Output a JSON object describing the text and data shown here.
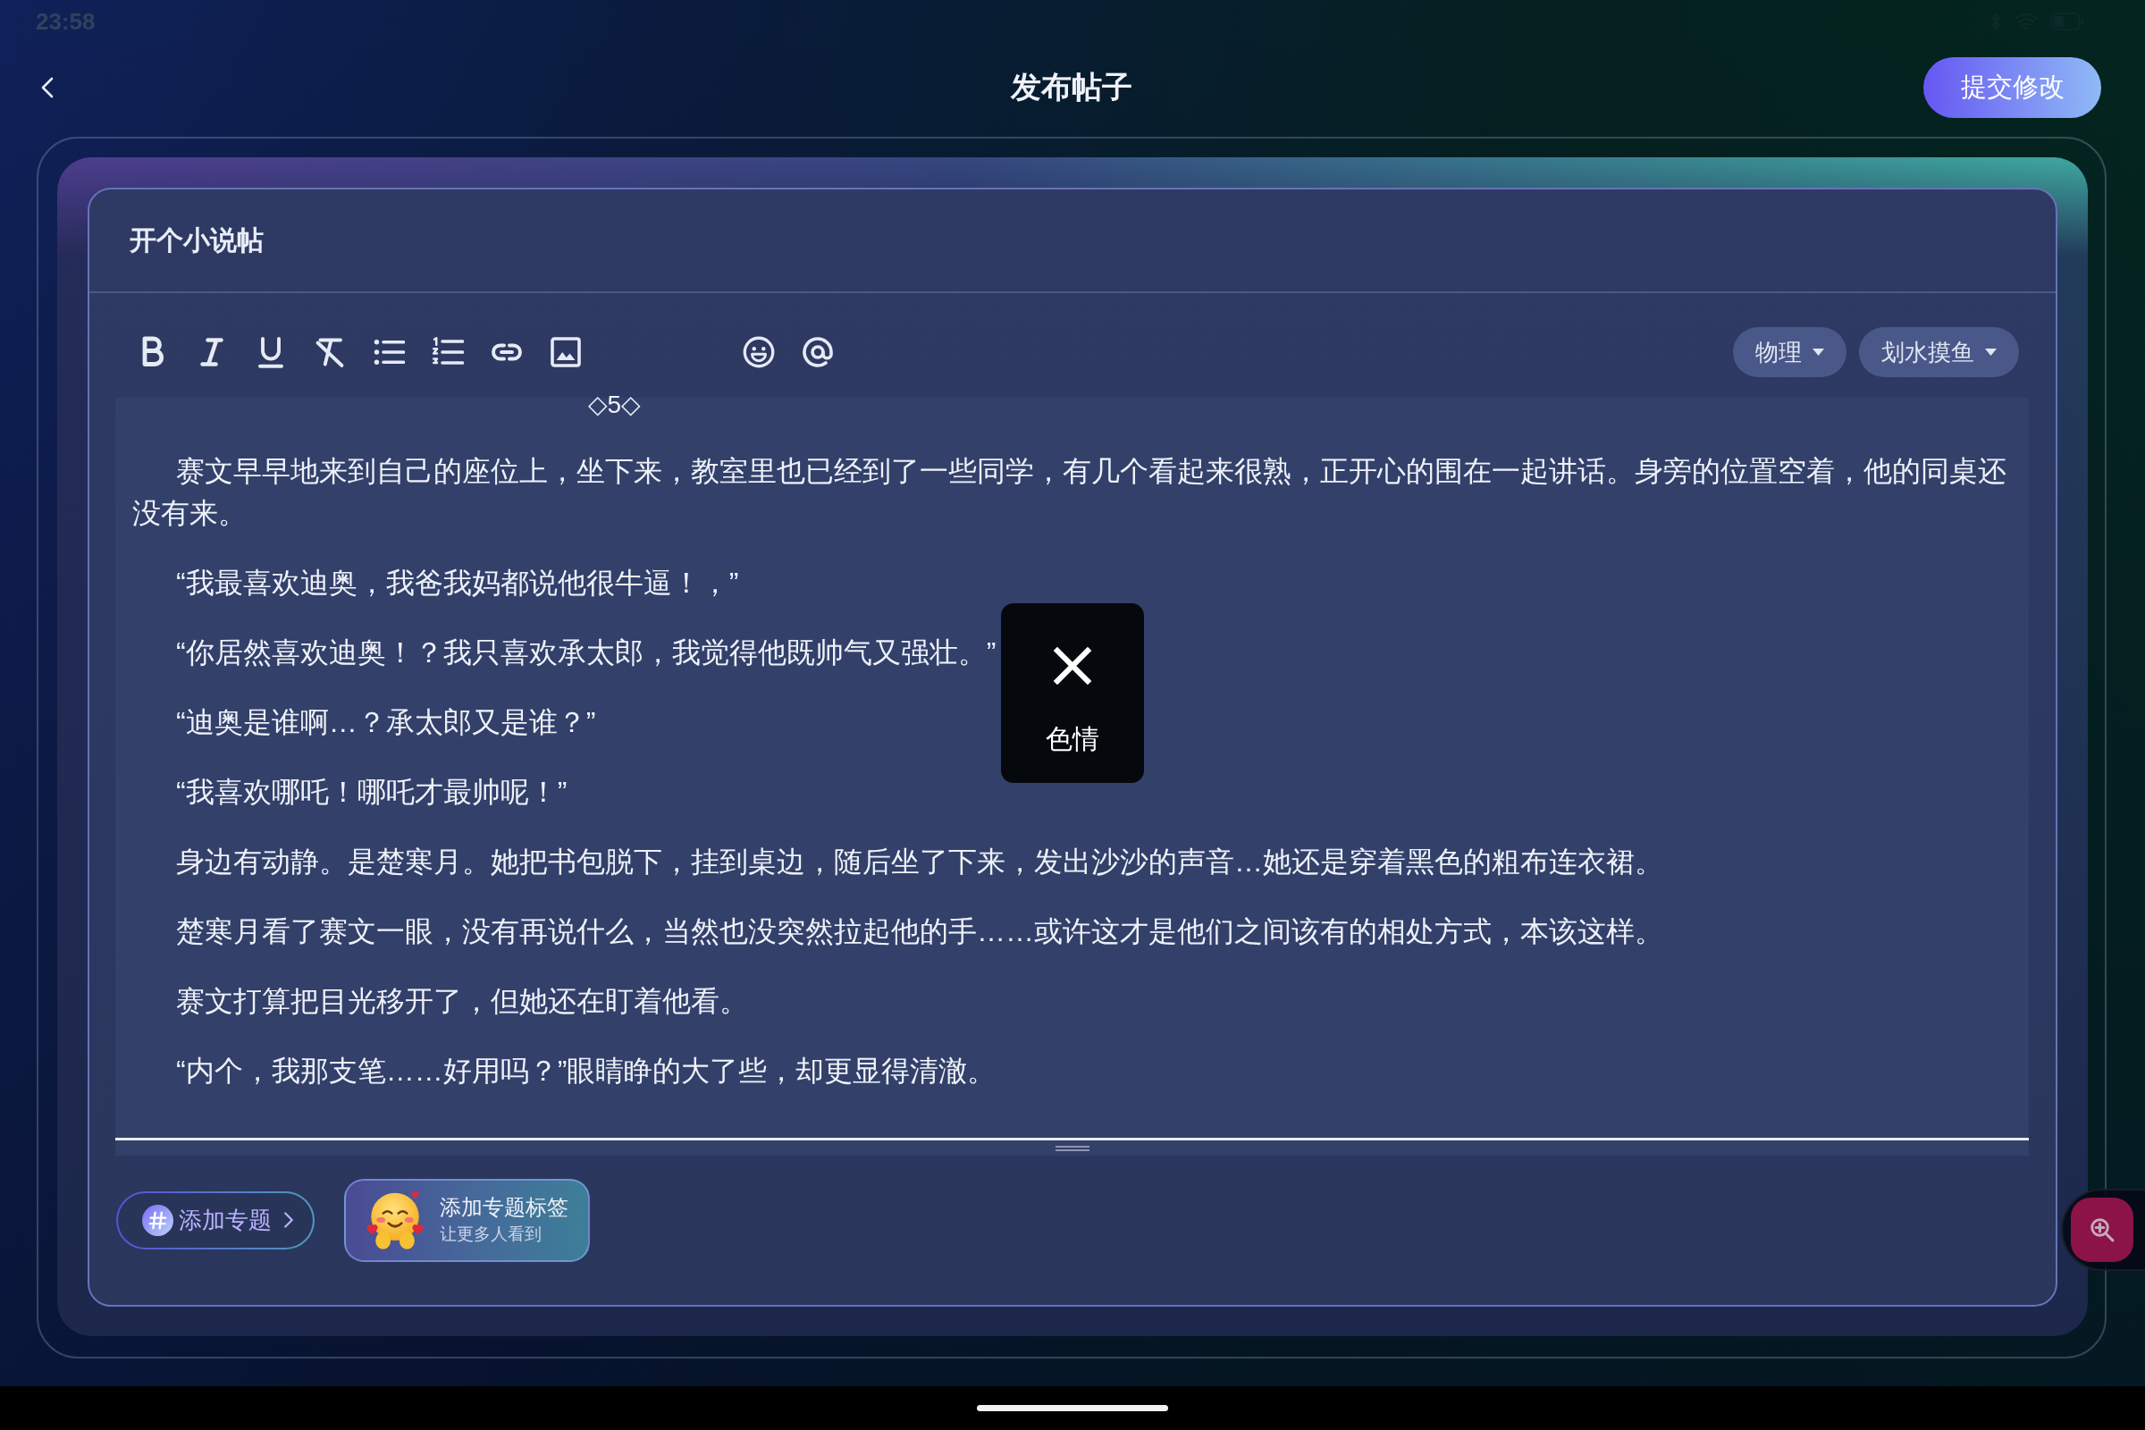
{
  "status_bar": {
    "time": "23:58"
  },
  "header": {
    "title": "发布帖子",
    "submit": "提交修改"
  },
  "post_title": "开个小说帖",
  "tag_dropdowns": [
    "物理",
    "划水摸鱼"
  ],
  "editor": {
    "marker": "◇5◇",
    "paragraphs": [
      "赛文早早地来到自己的座位上，坐下来，教室里也已经到了一些同学，有几个看起来很熟，正开心的围在一起讲话。身旁的位置空着，他的同桌还没有来。",
      "“我最喜欢迪奥，我爸我妈都说他很牛逼！，”",
      "“你居然喜欢迪奥！？我只喜欢承太郎，我觉得他既帅气又强壮。”",
      "“迪奥是谁啊…？承太郎又是谁？”",
      "“我喜欢哪吒！哪吒才最帅呢！”",
      "身边有动静。是楚寒月。她把书包脱下，挂到桌边，随后坐了下来，发出沙沙的声音…她还是穿着黑色的粗布连衣裙。",
      "楚寒月看了赛文一眼，没有再说什么，当然也没突然拉起他的手……或许这才是他们之间该有的相处方式，本该这样。",
      "赛文打算把目光移开了，但她还在盯着他看。",
      "“内个，我那支笔……好用吗？”眼睛睁的大了些，却更显得清澈。"
    ]
  },
  "toast": {
    "label": "色情"
  },
  "add_topic": "添加专题",
  "topic_hint": {
    "title": "添加专题标签",
    "subtitle": "让更多人看到"
  }
}
